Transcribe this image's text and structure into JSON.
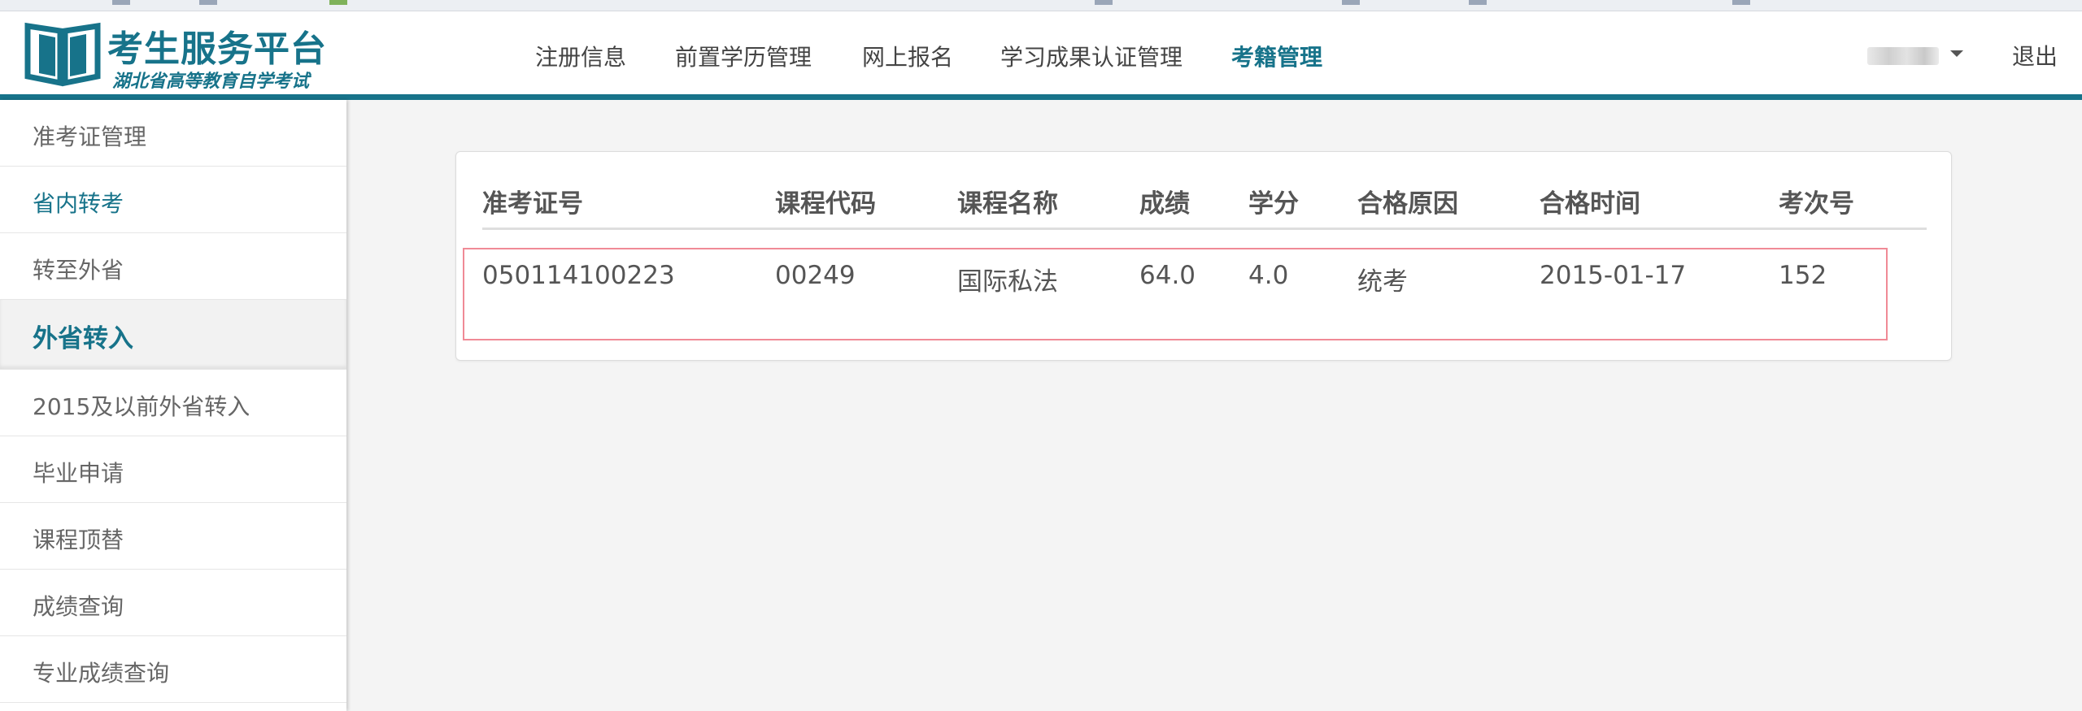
{
  "app": {
    "title": "考生服务平台",
    "subtitle": "湖北省高等教育自学考试",
    "accent_color": "#17738a"
  },
  "nav": {
    "items": [
      {
        "label": "注册信息",
        "active": false
      },
      {
        "label": "前置学历管理",
        "active": false
      },
      {
        "label": "网上报名",
        "active": false
      },
      {
        "label": "学习成果认证管理",
        "active": false
      },
      {
        "label": "考籍管理",
        "active": true
      }
    ],
    "logout_label": "退出",
    "user_icon": "chevron-down-icon"
  },
  "sidebar": {
    "items": [
      {
        "label": "准考证管理",
        "type": "item",
        "selected": false
      },
      {
        "label": "省内转考",
        "type": "item",
        "selected": true
      },
      {
        "label": "转至外省",
        "type": "item",
        "selected": false
      },
      {
        "label": "外省转入",
        "type": "group",
        "selected": false
      },
      {
        "label": "2015及以前外省转入",
        "type": "item",
        "selected": false
      },
      {
        "label": "毕业申请",
        "type": "item",
        "selected": false
      },
      {
        "label": "课程顶替",
        "type": "item",
        "selected": false
      },
      {
        "label": "成绩查询",
        "type": "item",
        "selected": false
      },
      {
        "label": "专业成绩查询",
        "type": "item",
        "selected": false
      }
    ]
  },
  "table": {
    "columns": [
      "准考证号",
      "课程代码",
      "课程名称",
      "成绩",
      "学分",
      "合格原因",
      "合格时间",
      "考次号"
    ],
    "rows": [
      [
        "050114100223",
        "00249",
        "国际私法",
        "64.0",
        "4.0",
        "统考",
        "2015-01-17",
        "152"
      ]
    ],
    "highlight_color": "#f08a96"
  }
}
